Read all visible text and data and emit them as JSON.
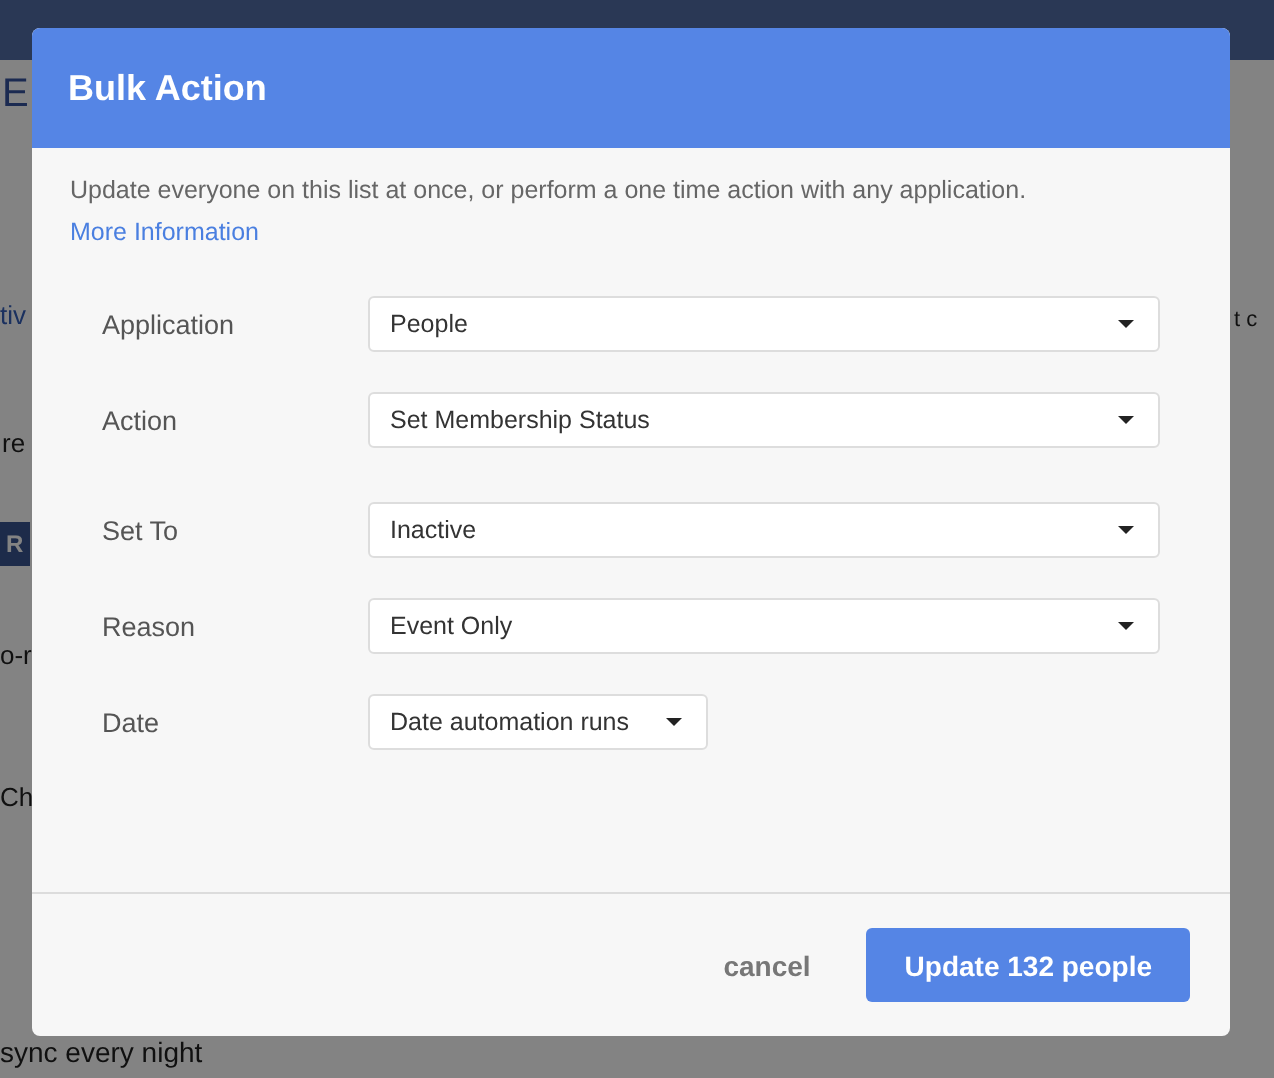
{
  "background": {
    "texts": [
      {
        "text": "E",
        "kind": "heading"
      },
      {
        "text": "tiv",
        "kind": "tab"
      },
      {
        "text": "re",
        "kind": "plain"
      },
      {
        "text": "R",
        "kind": "button"
      },
      {
        "text": "o-r",
        "kind": "plain"
      },
      {
        "text": "Ch",
        "kind": "plain"
      },
      {
        "text": "sync every night",
        "kind": "plain"
      },
      {
        "text": "t c",
        "kind": "plain"
      }
    ]
  },
  "dialog": {
    "title": "Bulk Action",
    "intro": "Update everyone on this list at once, or perform a one time action with any application.",
    "link": "More Information",
    "fields": [
      {
        "label": "Application",
        "value": "People",
        "kind": "wide"
      },
      {
        "label": "Action",
        "value": "Set Membership Status",
        "kind": "wide"
      },
      {
        "label": "Set To",
        "value": "Inactive",
        "kind": "wide"
      },
      {
        "label": "Reason",
        "value": "Event Only",
        "kind": "wide"
      },
      {
        "label": "Date",
        "value": "Date automation runs",
        "kind": "narrow"
      }
    ],
    "buttons": [
      {
        "label": "cancel",
        "kind": "link"
      },
      {
        "label": "Update 132 people",
        "kind": "primary"
      }
    ]
  }
}
